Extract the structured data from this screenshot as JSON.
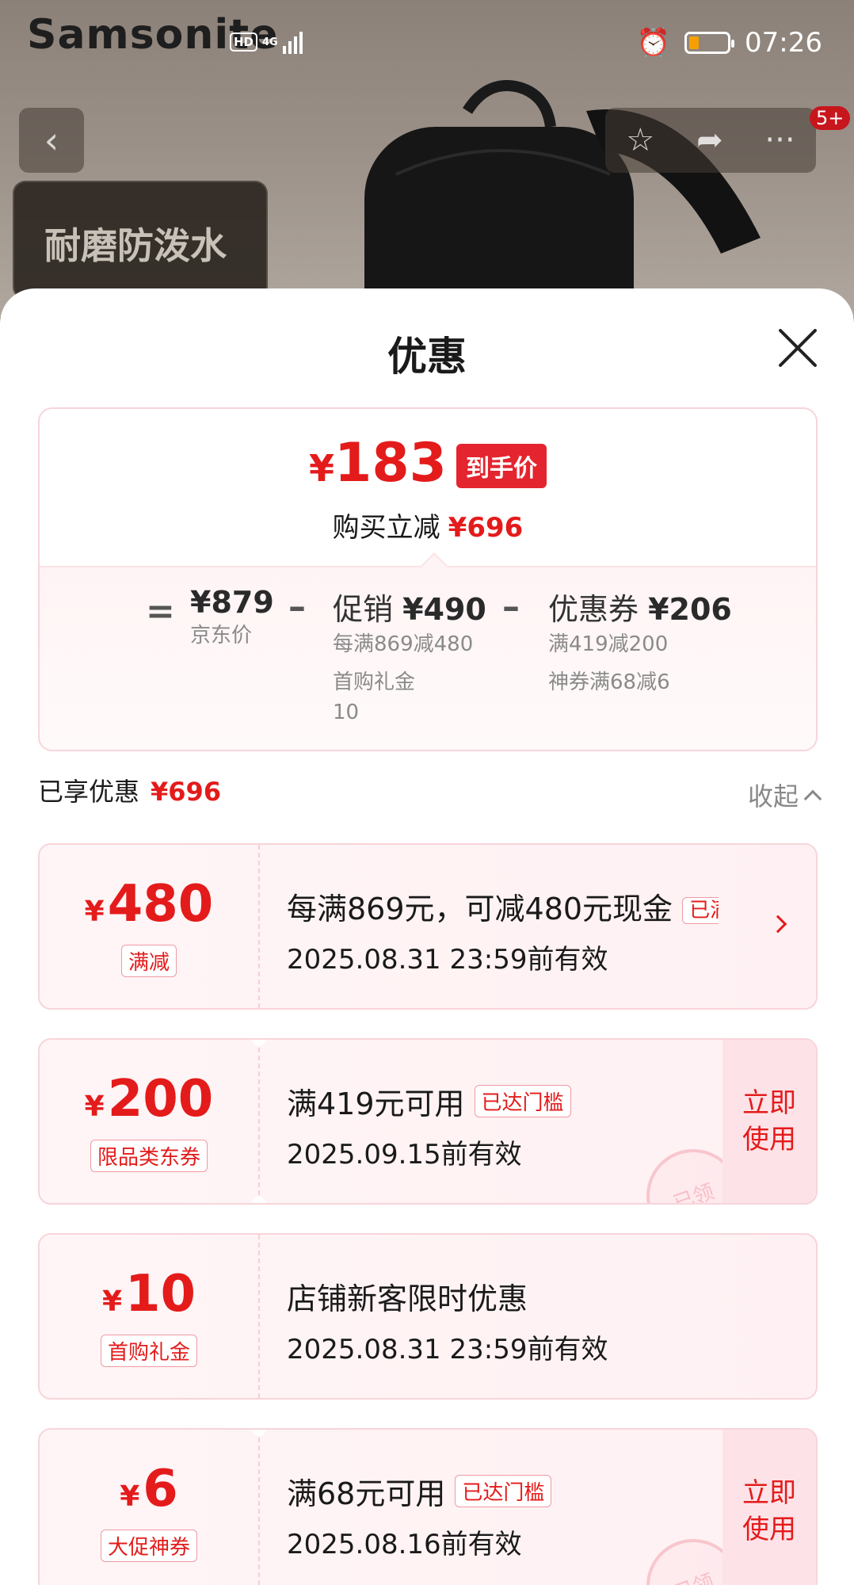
{
  "status_bar": {
    "brand": "Samsonite",
    "hd": "HD",
    "network": "4G",
    "time": "07:26"
  },
  "product_header": {
    "promo_tag": "耐磨防泼水",
    "notification_count": "5+"
  },
  "sheet": {
    "title": "优惠",
    "final_price": "183",
    "currency": "¥",
    "final_tag": "到手价",
    "save_label": "购买立减",
    "save_amount": "¥696",
    "breakdown": {
      "equals": "=",
      "jd_price": "¥879",
      "jd_label": "京东价",
      "minus": "–",
      "promo_label": "促销",
      "promo_value": "¥490",
      "promo_detail_1": "每满869减480",
      "promo_detail_2": "首购礼金",
      "promo_detail_3": "10",
      "coupon_label": "优惠券",
      "coupon_value": "¥206",
      "coupon_detail_1": "满419减200",
      "coupon_detail_2": "神券满68减6"
    },
    "enjoyed_label": "已享优惠",
    "enjoyed_amount": "¥696",
    "collapse_label": "收起"
  },
  "coupons": [
    {
      "amount": "480",
      "type": "满减",
      "desc": "每满869元，可减480元现金",
      "tag": "已满",
      "date": "2025.08.31 23:59前有效"
    },
    {
      "amount": "200",
      "type": "限品类东券",
      "desc": "满419元可用",
      "tag": "已达门槛",
      "date": "2025.09.15前有效",
      "action": "立即使用",
      "stamp": "已领"
    },
    {
      "amount": "10",
      "type": "首购礼金",
      "desc": "店铺新客限时优惠",
      "date": "2025.08.31 23:59前有效"
    },
    {
      "amount": "6",
      "type": "大促神券",
      "desc": "满68元可用",
      "tag": "已达门槛",
      "date": "2025.08.16前有效",
      "action": "立即使用",
      "stamp": "已领"
    }
  ],
  "colors": {
    "accent_red": "#e41b1b",
    "card_bg": "#fff1f3",
    "border_pink": "#f7d5da"
  }
}
